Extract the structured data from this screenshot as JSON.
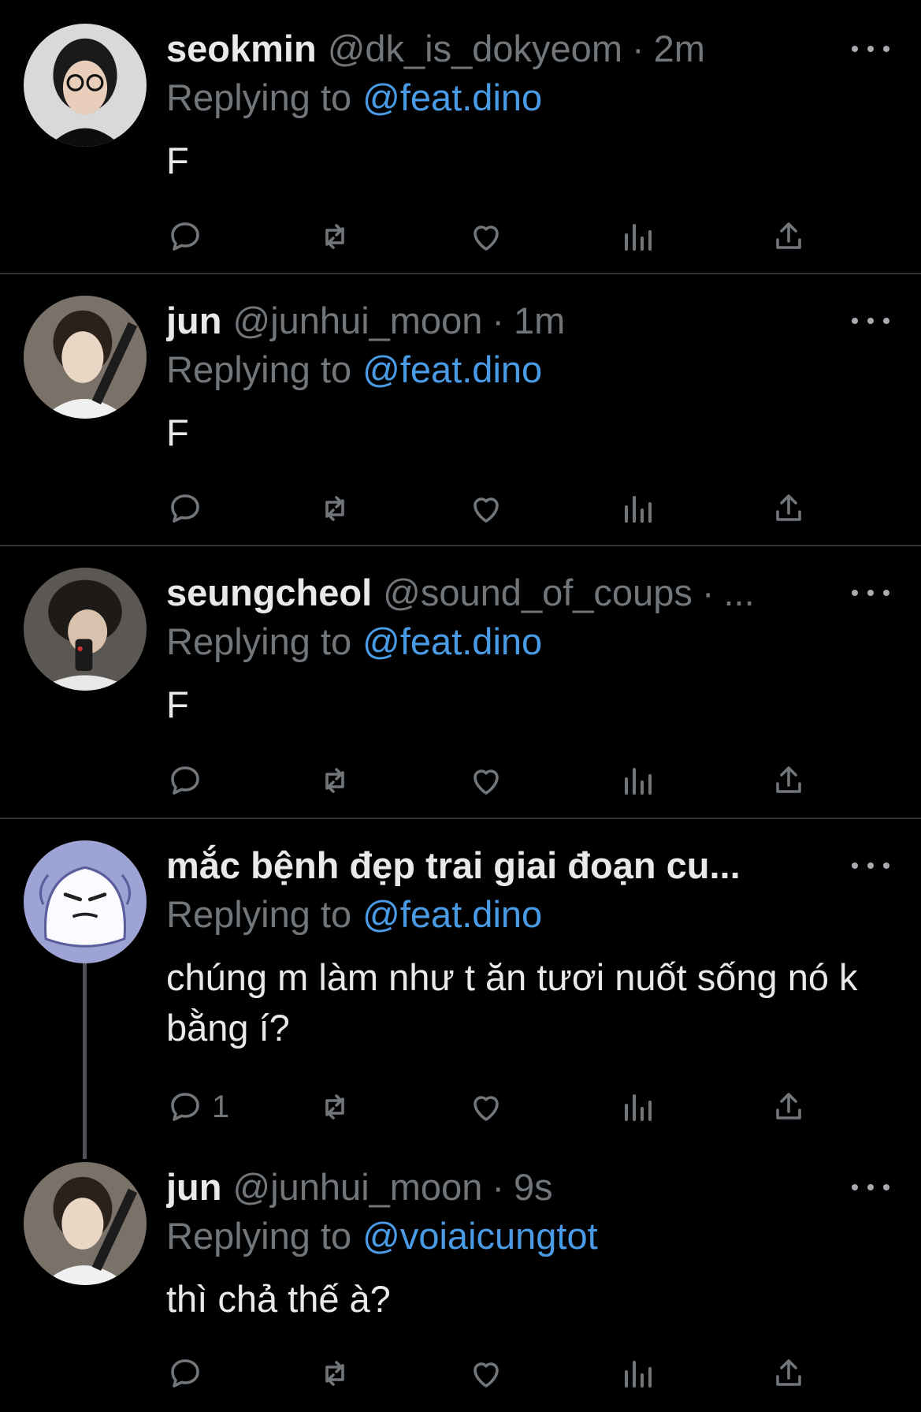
{
  "tweets": [
    {
      "name": "seokmin",
      "handle": "@dk_is_dokyeom",
      "dot": "·",
      "time": "2m",
      "replying_label": "Replying to",
      "replying_to": "@feat.dino",
      "text": "F",
      "reply_count": ""
    },
    {
      "name": "jun",
      "handle": "@junhui_moon",
      "dot": "·",
      "time": "1m",
      "replying_label": "Replying to",
      "replying_to": "@feat.dino",
      "text": "F",
      "reply_count": ""
    },
    {
      "name": "seungcheol",
      "handle": "@sound_of_coups",
      "dot": "·",
      "time": "...",
      "replying_label": "Replying to",
      "replying_to": "@feat.dino",
      "text": "F",
      "reply_count": ""
    },
    {
      "name": "mắc bệnh đẹp trai giai đoạn cu...",
      "handle": "",
      "dot": "",
      "time": "",
      "replying_label": "Replying to",
      "replying_to": "@feat.dino",
      "text": "chúng m làm như t ăn tươi nuốt sống nó k bằng í?",
      "reply_count": "1"
    },
    {
      "name": "jun",
      "handle": "@junhui_moon",
      "dot": "·",
      "time": "9s",
      "replying_label": "Replying to",
      "replying_to": "@voiaicungtot",
      "text": "thì chả thế à?",
      "reply_count": ""
    }
  ],
  "icons": [
    "more-icon",
    "reply-icon",
    "retweet-icon",
    "like-icon",
    "views-icon",
    "share-icon"
  ],
  "colors": {
    "background": "#000000",
    "text": "#e7e9ea",
    "muted": "#71767b",
    "mention": "#4a9be6",
    "divider": "#2f3336"
  }
}
